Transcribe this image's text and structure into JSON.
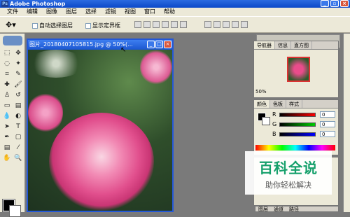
{
  "app": {
    "title": "Adobe Photoshop",
    "icon_label": "Ps",
    "window_controls": [
      "minimize-icon",
      "restore-icon",
      "close-icon"
    ]
  },
  "menu": {
    "items": [
      {
        "label": "文件"
      },
      {
        "label": "编辑"
      },
      {
        "label": "图像"
      },
      {
        "label": "图层"
      },
      {
        "label": "选择"
      },
      {
        "label": "滤镜"
      },
      {
        "label": "视图"
      },
      {
        "label": "窗口"
      },
      {
        "label": "帮助"
      }
    ]
  },
  "options": {
    "tool_icon": "move-icon",
    "auto_select_layer": "自动选择图层",
    "show_bounding_box": "显示定界框"
  },
  "document": {
    "title": "图片_20180407105815.jpg @ 50%(..."
  },
  "navigator": {
    "tabs": [
      "导航器",
      "信息",
      "直方图"
    ],
    "zoom": "50%"
  },
  "color_panel": {
    "tabs": [
      "颜色",
      "色板",
      "样式"
    ],
    "channels": [
      {
        "label": "R",
        "value": "0"
      },
      {
        "label": "G",
        "value": "0"
      },
      {
        "label": "B",
        "value": "0"
      }
    ]
  },
  "layers_panel": {
    "tabs": [
      "图层",
      "通道",
      "路径"
    ]
  },
  "watermark": {
    "title": "百科全说",
    "subtitle": "助你轻松解决"
  },
  "colors": {
    "title_blue": "#0a48c8",
    "ui_gray": "#ece9d8",
    "workspace": "#7a7a7a",
    "watermark_green": "#16a06b"
  }
}
